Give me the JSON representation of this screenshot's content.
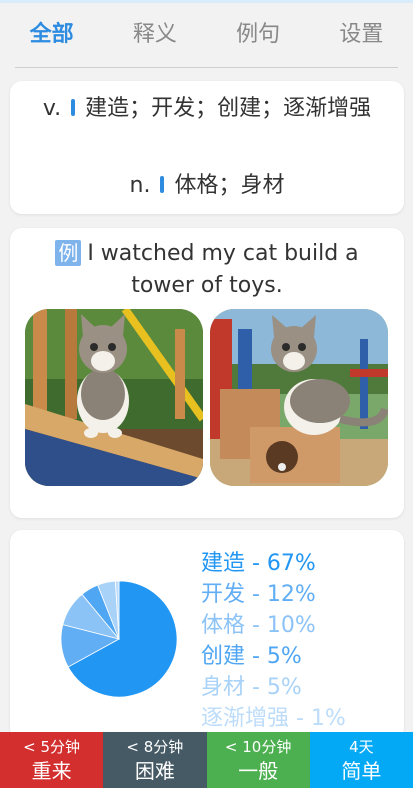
{
  "tabs": [
    {
      "label": "全部",
      "active": true
    },
    {
      "label": "释义",
      "active": false
    },
    {
      "label": "例句",
      "active": false
    },
    {
      "label": "设置",
      "active": false
    }
  ],
  "definitions": [
    {
      "pos": "v.",
      "meaning": "建造；开发；创建；逐渐增强"
    },
    {
      "pos": "n.",
      "meaning": "体格；身材"
    }
  ],
  "example": {
    "badge": "例",
    "sentence": "I watched my cat build a tower of toys."
  },
  "chart_data": {
    "type": "pie",
    "categories": [
      "建造",
      "开发",
      "体格",
      "创建",
      "身材",
      "逐渐增强"
    ],
    "values": [
      67,
      12,
      10,
      5,
      5,
      1
    ],
    "labels": [
      "建造 - 67%",
      "开发 - 12%",
      "体格 - 10%",
      "创建 - 5%",
      "身材 - 5%",
      "逐渐增强 - 1%"
    ],
    "colors": [
      "#2196f3",
      "#62aef5",
      "#8cc3f7",
      "#4fa6f3",
      "#a9d2f8",
      "#bcdcfa"
    ],
    "legend": "right"
  },
  "footer": [
    {
      "time": "< 5分钟",
      "label": "重来",
      "color": "#d32f2f"
    },
    {
      "time": "< 8分钟",
      "label": "困难",
      "color": "#455a64"
    },
    {
      "time": "< 10分钟",
      "label": "一般",
      "color": "#4caf50"
    },
    {
      "time": "4天",
      "label": "简单",
      "color": "#03a9f4"
    }
  ]
}
